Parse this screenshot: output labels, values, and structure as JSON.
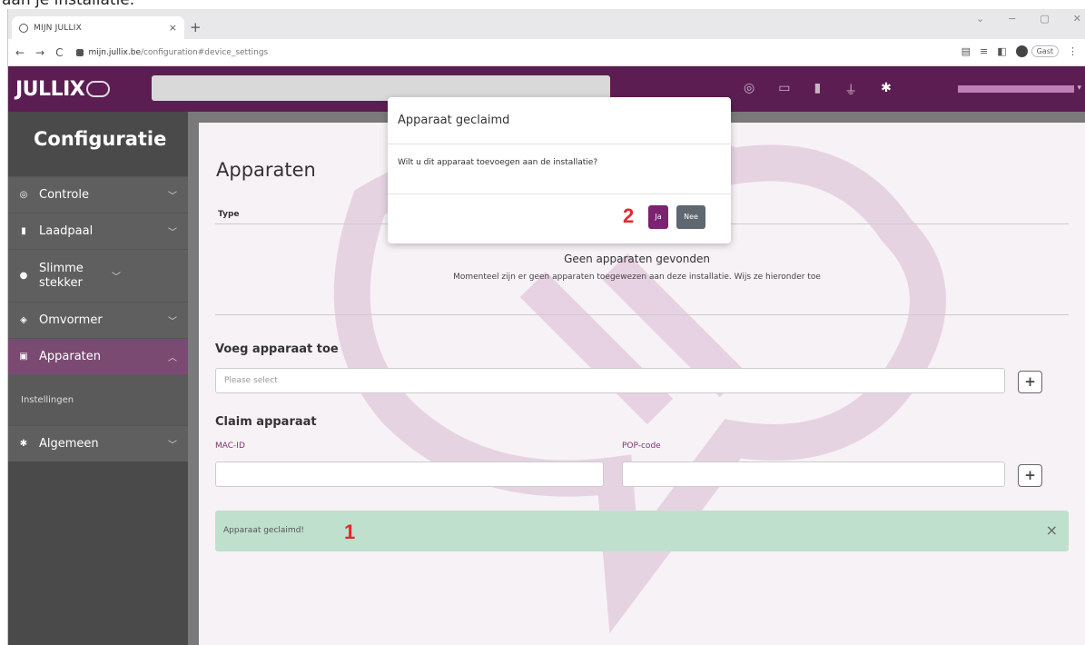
{
  "caption": "aan je installatie.",
  "browser": {
    "tab_title": "MIJN JULLIX",
    "tab_close": "×",
    "new_tab": "+",
    "window_controls": [
      "⌄",
      "−",
      "▢",
      "✕"
    ],
    "url_domain": "mijn.jullix.be",
    "url_path": "/configuration#device_settings",
    "profile_label": "Gast"
  },
  "app": {
    "logo_text": "JULLIX"
  },
  "sidebar": {
    "title": "Configuratie",
    "items": [
      {
        "label": "Controle",
        "icon": "controller-icon"
      },
      {
        "label": "Laadpaal",
        "icon": "charger-icon"
      },
      {
        "label": "Slimme stekker",
        "icon": "plug-icon"
      },
      {
        "label": "Omvormer",
        "icon": "inverter-icon"
      },
      {
        "label": "Apparaten",
        "icon": "devices-icon"
      },
      {
        "label": "Algemeen",
        "icon": "gear-icon"
      }
    ],
    "sub_item": "Instellingen"
  },
  "main": {
    "title": "Apparaten",
    "type_header": "Type",
    "empty_title": "Geen apparaten gevonden",
    "empty_desc": "Momenteel zijn er geen apparaten toegewezen aan deze installatie. Wijs ze hieronder toe",
    "add_heading": "Voeg apparaat toe",
    "select_placeholder": "Please select",
    "plus": "+",
    "claim_heading": "Claim apparaat",
    "mac_label": "MAC-ID",
    "pop_label": "POP-code",
    "alert_text": "Apparaat geclaimd!",
    "alert_close": "×"
  },
  "modal": {
    "title": "Apparaat geclaimd",
    "body": "Wilt u dit apparaat toevoegen aan de installatie?",
    "yes_label": "Ja",
    "no_label": "Nee"
  },
  "annotations": {
    "step1": "1",
    "step2": "2"
  },
  "colors": {
    "brand_purple": "#5c1e52",
    "button_purple": "#7b2371",
    "alert_green": "#bfe0cd",
    "step_red": "#e8262b"
  }
}
